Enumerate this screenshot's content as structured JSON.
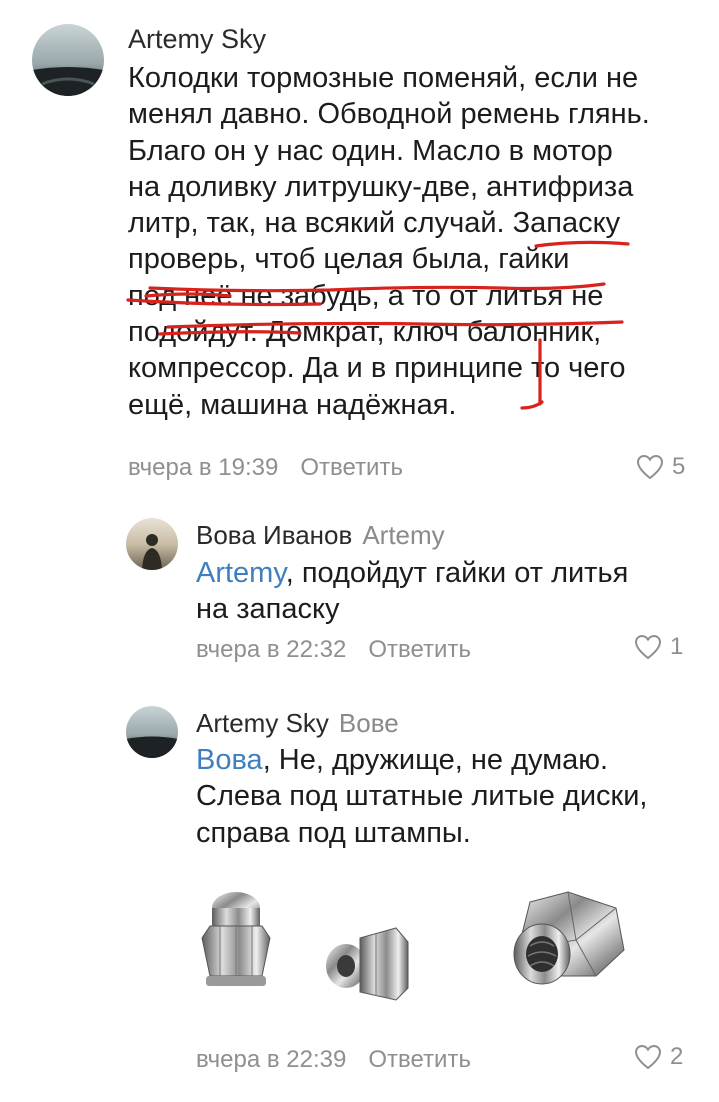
{
  "comments": [
    {
      "author": "Artemy Sky",
      "reply_to": "",
      "mention": "",
      "lines": [
        "Колодки тормозные поменяй, если не",
        "менял давно. Обводной ремень глянь.",
        "Благо он у нас один. Масло в мотор",
        "на доливку литрушку-две, антифриза",
        "литр, так, на всякий случай. Запаску",
        "проверь, чтоб целая была, гайки",
        "под неё не забудь, а то от литья не",
        "подойдут. Домкрат, ключ балонник,",
        "компрессор. Да и в принципе то чего",
        "ещё, машина надёжная."
      ],
      "time": "вчера в 19:39",
      "reply_label": "Ответить",
      "likes": "5"
    },
    {
      "author": "Вова Иванов",
      "reply_to": "Artemy",
      "mention": "Artemy",
      "lines_after_mention": [
        ", подойдут гайки от литья",
        "на запаску"
      ],
      "time": "вчера в 22:32",
      "reply_label": "Ответить",
      "likes": "1"
    },
    {
      "author": "Artemy Sky",
      "reply_to": "Вове",
      "mention": "Вова",
      "lines_after_mention": [
        ", Не, дружище, не думаю.",
        "Слева под штатные литые диски,",
        "справа под штампы."
      ],
      "time": "вчера в 22:39",
      "reply_label": "Ответить",
      "likes": "2"
    }
  ],
  "icons": {
    "like": "heart-outline-icon"
  },
  "colors": {
    "mention": "#3f7fc1",
    "meta": "#8f8f8f",
    "annotation": "#d9221c"
  }
}
